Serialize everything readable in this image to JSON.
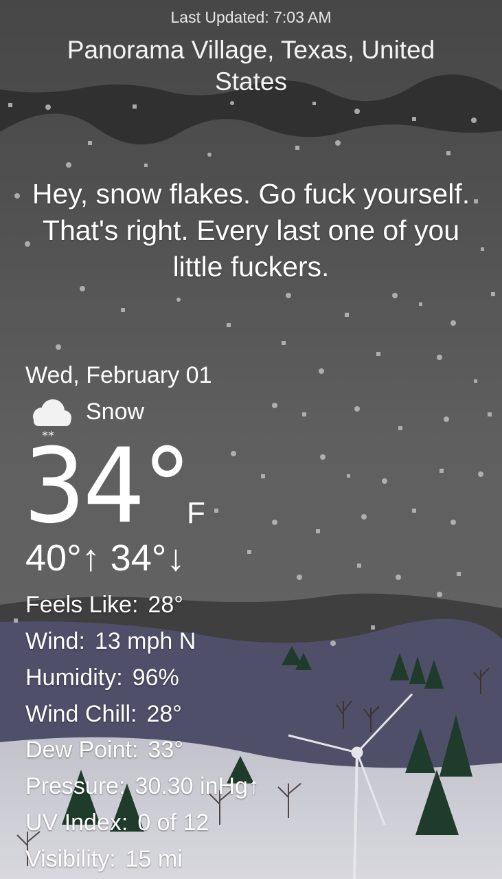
{
  "header": {
    "last_updated": "Last Updated: 7:03 AM",
    "location": "Panorama Village, Texas, United States"
  },
  "commentary": "Hey, snow flakes. Go fuck yourself. That's right. Every last one of you little fuckers.",
  "current": {
    "date": "Wed, February 01",
    "condition": "Snow",
    "condition_icon": "snow-cloud-icon",
    "temperature": "34°",
    "unit": "F",
    "high_low": "40°↑ 34°↓"
  },
  "details": [
    {
      "label": "Feels Like:",
      "value": "28°"
    },
    {
      "label": "Wind:",
      "value": "13 mph N"
    },
    {
      "label": "Humidity:",
      "value": "96%"
    },
    {
      "label": "Wind Chill:",
      "value": "28°"
    },
    {
      "label": "Dew Point:",
      "value": "33°"
    },
    {
      "label": "Pressure:",
      "value": "30.30 inHg↑"
    },
    {
      "label": "UV Index:",
      "value": "0 of 12"
    },
    {
      "label": "Visibility:",
      "value": "15 mi"
    }
  ],
  "colors": {
    "sky_top": "#474747",
    "sky_mid": "#5f5f5f",
    "hills": "#4c4c66",
    "snow_ground": "#d0d0d8",
    "trees": "#1f3b2c"
  }
}
